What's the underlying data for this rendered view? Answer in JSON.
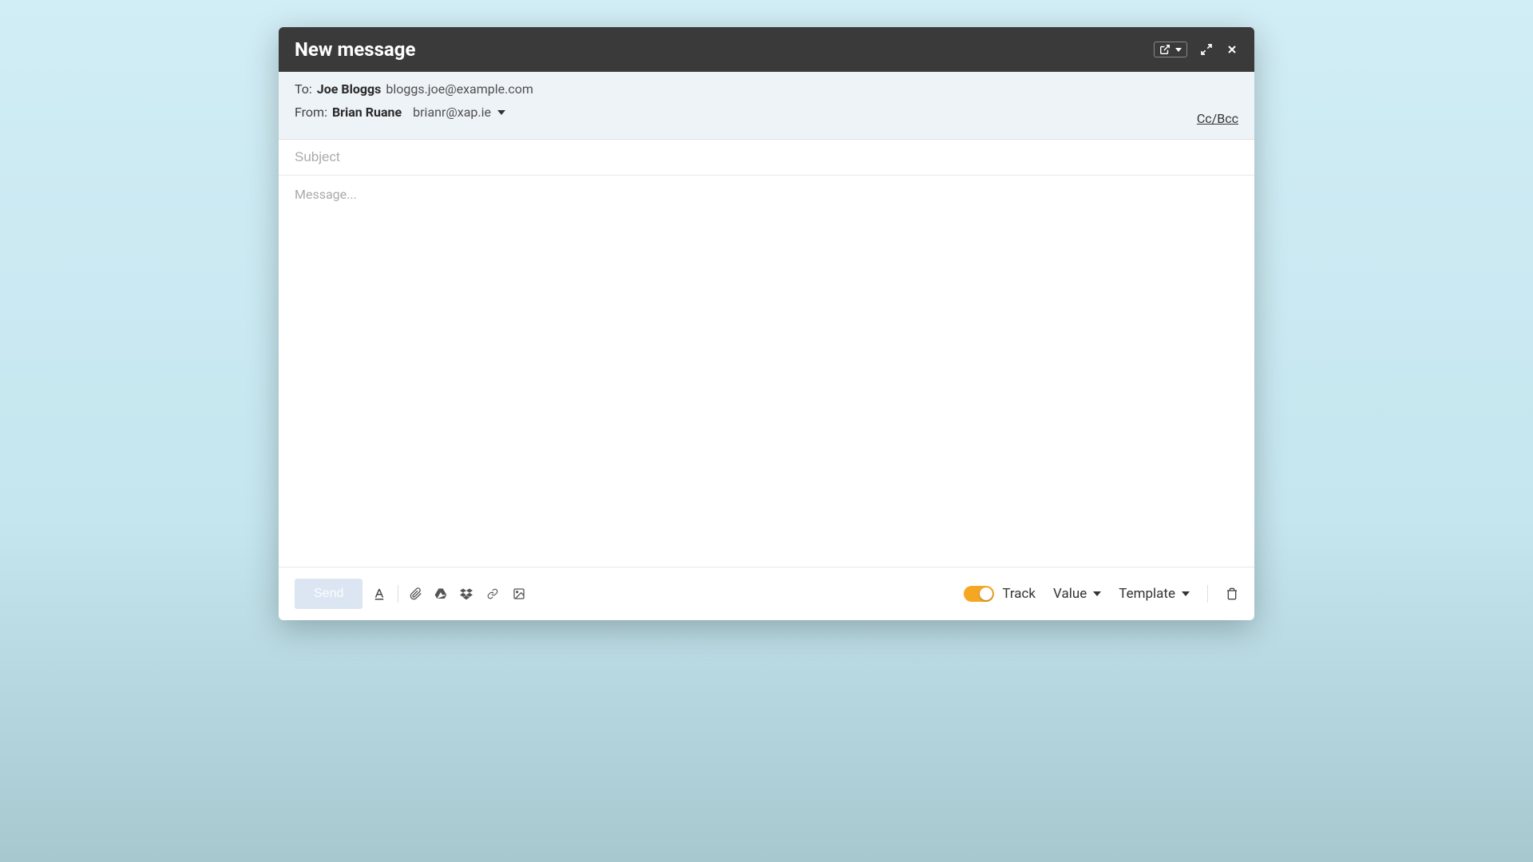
{
  "header": {
    "title": "New message"
  },
  "recipients": {
    "to_label": "To:",
    "to_name": "Joe Bloggs",
    "to_email": "bloggs.joe@example.com",
    "from_label": "From:",
    "from_name": "Brian Ruane",
    "from_email": "brianr@xap.ie",
    "ccbcc_label": "Cc/Bcc"
  },
  "subject": {
    "placeholder": "Subject",
    "value": ""
  },
  "body": {
    "placeholder": "Message...",
    "value": ""
  },
  "footer": {
    "send_label": "Send",
    "track_label": "Track",
    "value_label": "Value",
    "template_label": "Template"
  }
}
